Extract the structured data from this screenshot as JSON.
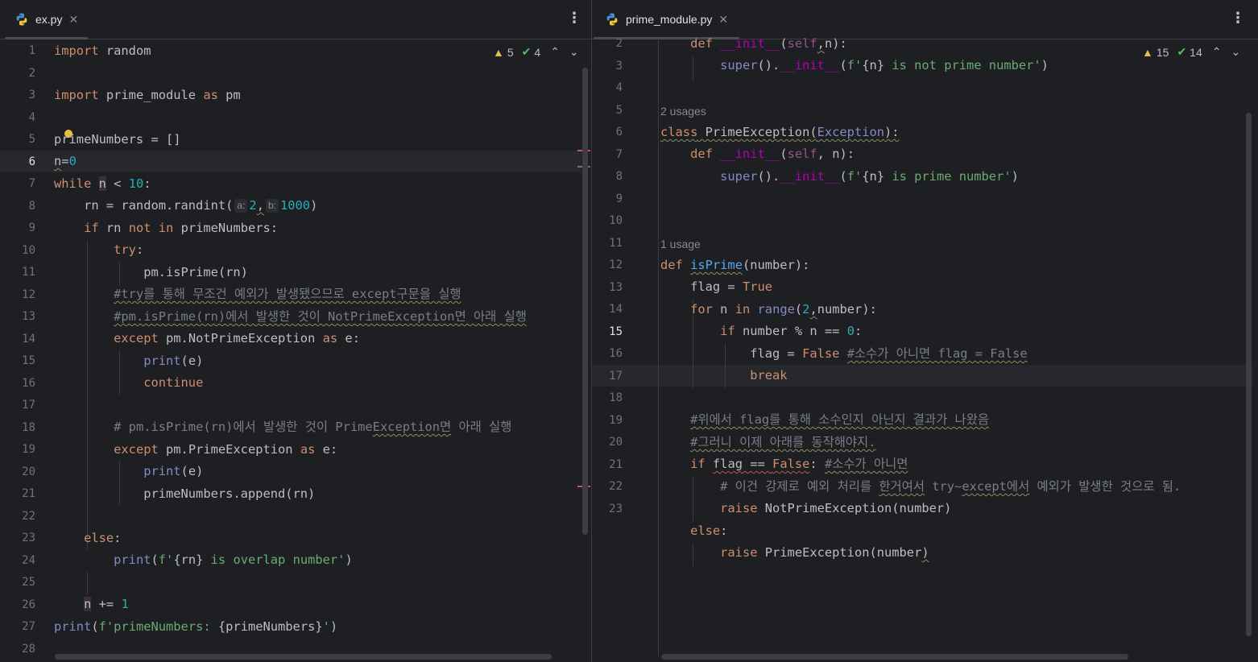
{
  "left": {
    "tab_label": "ex.py",
    "warnings": "5",
    "checks": "4",
    "current_line": 6,
    "lines": [
      "import random",
      "",
      "import prime_module as pm",
      "",
      "primeNumbers = []",
      "n=0",
      "while n < 10:",
      "    rn = random.randint( a: 2, b: 1000)",
      "    if rn not in primeNumbers:",
      "        try:",
      "            pm.isPrime(rn)",
      "        #try를 통해 무조건 예외가 발생됐으므로 except구문을 실행",
      "        #pm.isPrime(rn)에서 발생한 것이 NotPrimeException면 아래 실행",
      "        except pm.NotPrimeException as e:",
      "            print(e)",
      "            continue",
      "",
      "        # pm.isPrime(rn)에서 발생한 것이 PrimeException면 아래 실행",
      "        except pm.PrimeException as e:",
      "            print(e)",
      "            primeNumbers.append(rn)",
      "",
      "    else:",
      "        print(f'{rn} is overlap number')",
      "",
      "    n += 1",
      "print(f'primeNumbers: {primeNumbers}')",
      ""
    ],
    "line_numbers": [
      "1",
      "2",
      "3",
      "4",
      "5",
      "6",
      "7",
      "8",
      "9",
      "10",
      "11",
      "12",
      "13",
      "14",
      "15",
      "16",
      "17",
      "18",
      "19",
      "20",
      "21",
      "22",
      "23",
      "24",
      "25",
      "26",
      "27",
      "28"
    ]
  },
  "right": {
    "tab_label": "prime_module.py",
    "warnings": "15",
    "checks": "14",
    "current_line": 15,
    "usage_labels": [
      "2 usages",
      "1 usage"
    ],
    "line_numbers": [
      "2",
      "3",
      "4",
      "5",
      "6",
      "7",
      "8",
      "9",
      "10",
      "11",
      "12",
      "13",
      "14",
      "15",
      "16",
      "17",
      "18",
      "19",
      "20",
      "21",
      "22",
      "23"
    ]
  },
  "icons": [
    "python-file-icon",
    "close-icon",
    "more-options-icon",
    "warning-icon",
    "check-icon",
    "chevron-up-icon",
    "chevron-down-icon",
    "intention-bulb-icon"
  ]
}
